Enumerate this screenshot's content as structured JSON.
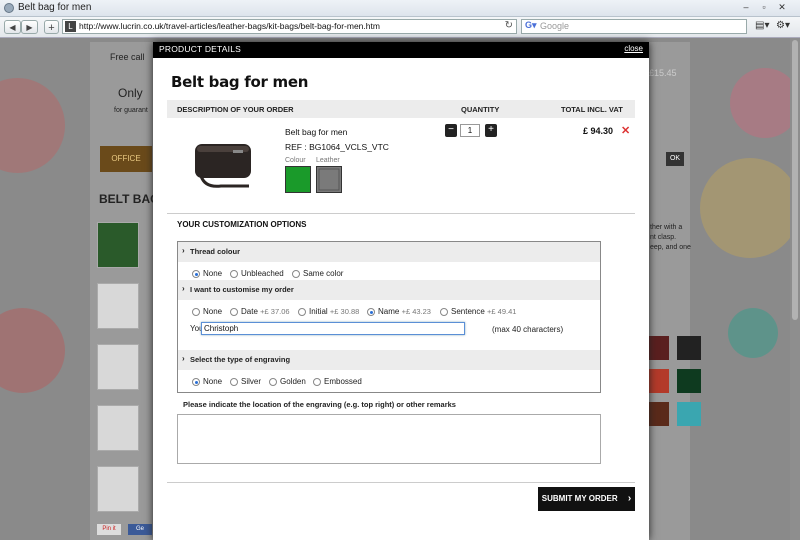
{
  "browser": {
    "window_title": "Belt bag for men",
    "url": "http://www.lucrin.co.uk/travel-articles/leather-bags/kit-bags/belt-bag-for-men.htm",
    "search_placeholder": "Google",
    "back": "◀",
    "forward": "▶",
    "new_tab": "+",
    "page_menu": "▤▾",
    "tools_menu": "⚙▾"
  },
  "background_page": {
    "free_call": "Free call",
    "only": "Only",
    "guarantee": "for guarant",
    "office_menu": "OFFICE",
    "belt_bag_heading": "BELT BAG",
    "ok": "OK",
    "price_text": "£15.45",
    "right_text_1": "ther with a",
    "right_text_2": "nt clasp.",
    "right_text_3": "eep, and one",
    "pin": "Pin it",
    "fb": "Ge",
    "swatch_colors": [
      "#5a1f1f",
      "#222222",
      "#b33a2a",
      "#0e3a1f",
      "#5a2a1a",
      "#3aa6b0"
    ]
  },
  "modal": {
    "header": "PRODUCT DETAILS",
    "close": "close",
    "title": "Belt bag for men",
    "table_headers": {
      "description": "DESCRIPTION OF YOUR ORDER",
      "quantity": "QUANTITY",
      "total": "TOTAL INCL. VAT"
    },
    "product": {
      "name": "Belt bag for men",
      "ref": "REF : BG1064_VCLS_VTC",
      "colour_label": "Colour",
      "leather_label": "Leather",
      "colour_hex": "#1a9a2a",
      "leather_hex": "#7a7a7a",
      "quantity": "1",
      "minus": "−",
      "plus": "+",
      "price": "£ 94.30",
      "remove": "✕"
    },
    "customization": {
      "title": "YOUR CUSTOMIZATION OPTIONS",
      "thread": {
        "heading": "Thread colour",
        "options": [
          "None",
          "Unbleached",
          "Same color"
        ],
        "selected": 0
      },
      "customise": {
        "heading": "I want to customise my order",
        "options": [
          {
            "label": "None",
            "price": ""
          },
          {
            "label": "Date",
            "price": "+£ 37.06"
          },
          {
            "label": "Initial",
            "price": "+£ 30.88"
          },
          {
            "label": "Name",
            "price": "+£ 43.23"
          },
          {
            "label": "Sentence",
            "price": "+£ 49.41"
          }
        ],
        "selected": 3,
        "text_label": "Your text",
        "text_value": "Christoph",
        "max_note": "(max 40 characters)"
      },
      "engraving": {
        "heading": "Select the type of engraving",
        "options": [
          "None",
          "Silver",
          "Golden",
          "Embossed"
        ],
        "selected": 0
      }
    },
    "remarks_label": "Please indicate the location of the engraving (e.g. top right) or other remarks",
    "remarks_value": "",
    "submit": "SUBMIT MY ORDER",
    "submit_arrow": "›"
  }
}
